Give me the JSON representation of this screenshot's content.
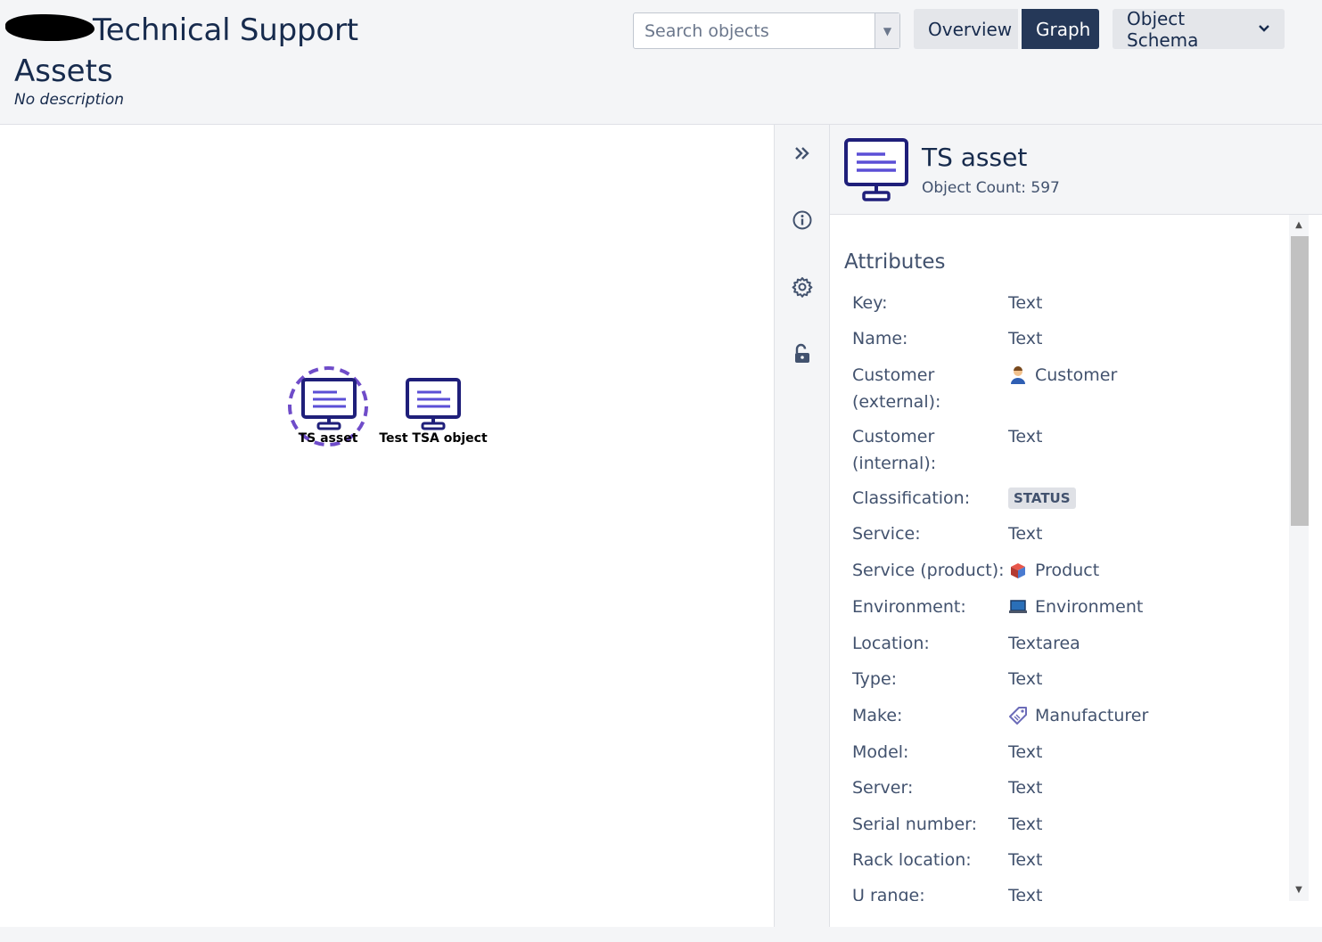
{
  "header": {
    "title": "Technical Support",
    "subtitle": "Assets",
    "description": "No description"
  },
  "search": {
    "placeholder": "Search objects"
  },
  "nav": {
    "overview": "Overview",
    "graph": "Graph",
    "schema": "Object Schema"
  },
  "graph": {
    "nodes": [
      {
        "label": "TS asset",
        "selected": true
      },
      {
        "label": "Test TSA object",
        "selected": false
      }
    ]
  },
  "panel": {
    "title": "TS asset",
    "count": "Object Count: 597",
    "attributes_heading": "Attributes",
    "attributes": [
      {
        "key": "Key:",
        "value": "Text"
      },
      {
        "key": "Name:",
        "value": "Text"
      },
      {
        "key": "Customer (external):",
        "value": "Customer",
        "icon": "customer-icon"
      },
      {
        "key": "Customer (internal):",
        "value": "Text"
      },
      {
        "key": "Classification:",
        "value": "STATUS",
        "lozenge": true
      },
      {
        "key": "Service:",
        "value": "Text"
      },
      {
        "key": "Service (product):",
        "value": "Product",
        "icon": "product-icon"
      },
      {
        "key": "Environment:",
        "value": "Environment",
        "icon": "environment-icon"
      },
      {
        "key": "Location:",
        "value": "Textarea"
      },
      {
        "key": "Type:",
        "value": "Text"
      },
      {
        "key": "Make:",
        "value": "Manufacturer",
        "icon": "tag-icon"
      },
      {
        "key": "Model:",
        "value": "Text"
      },
      {
        "key": "Server:",
        "value": "Text"
      },
      {
        "key": "Serial number:",
        "value": "Text"
      },
      {
        "key": "Rack location:",
        "value": "Text"
      },
      {
        "key": "U range:",
        "value": "Text"
      }
    ]
  },
  "colors": {
    "accent": "#253858",
    "monitor": "#1f1f7a",
    "monitor_lines": "#5b4fd6",
    "selection_ring": "#6f4cc9"
  }
}
